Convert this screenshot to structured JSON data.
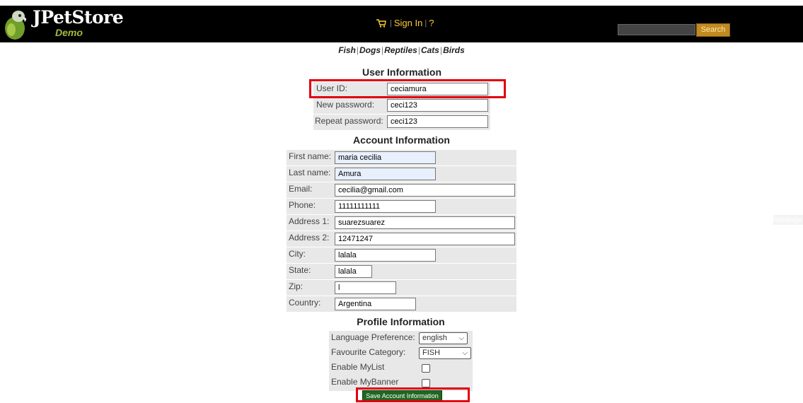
{
  "header": {
    "logo_title": "JPetStore",
    "logo_subtitle": "Demo",
    "sign_in": "Sign In",
    "help": "?",
    "search_button": "Search",
    "search_value": ""
  },
  "quick_links": [
    "Fish",
    "Dogs",
    "Reptiles",
    "Cats",
    "Birds"
  ],
  "user_info": {
    "title": "User Information",
    "user_id_label": "User ID:",
    "user_id_value": "ceciamura",
    "new_password_label": "New password:",
    "new_password_value": "ceci123",
    "repeat_password_label": "Repeat password:",
    "repeat_password_value": "ceci123"
  },
  "account_info": {
    "title": "Account Information",
    "first_name_label": "First name:",
    "first_name_value": "maria cecilia",
    "last_name_label": "Last name:",
    "last_name_value": "Amura",
    "email_label": "Email:",
    "email_value": "cecilia@gmail.com",
    "phone_label": "Phone:",
    "phone_value": "11111111111",
    "address1_label": "Address 1:",
    "address1_value": "suarezsuarez",
    "address2_label": "Address 2:",
    "address2_value": "12471247",
    "city_label": "City:",
    "city_value": "lalala",
    "state_label": "State:",
    "state_value": "lalala",
    "zip_label": "Zip:",
    "zip_value": "l",
    "country_label": "Country:",
    "country_value": "Argentina"
  },
  "profile_info": {
    "title": "Profile Information",
    "language_label": "Language Preference:",
    "language_value": "english",
    "category_label": "Favourite Category:",
    "category_value": "FISH",
    "mylist_label": "Enable MyList",
    "mybanner_label": "Enable MyBanner"
  },
  "save_button": "Save Account Information",
  "side_tag": "Rectangle",
  "colors": {
    "header_bg": "#000000",
    "accent": "#ffcc33",
    "highlight": "#e0000f",
    "save_bg": "#226622"
  }
}
